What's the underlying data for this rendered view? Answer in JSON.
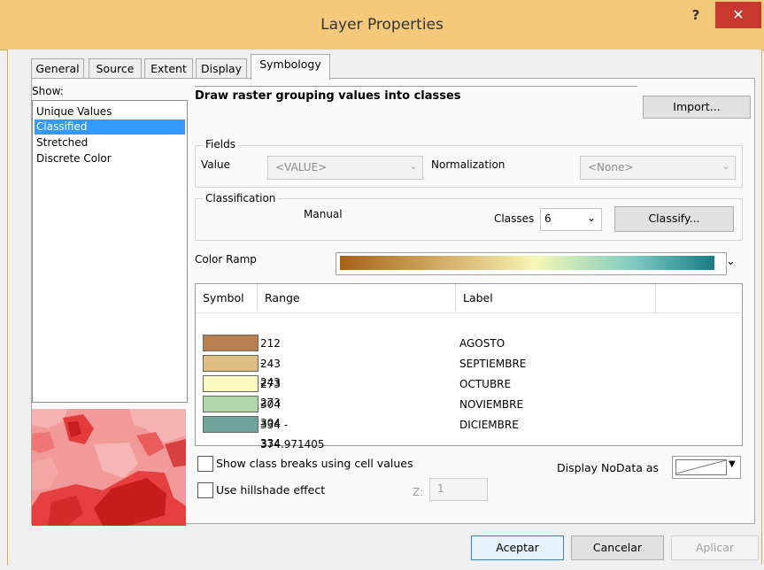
{
  "window": {
    "title": "Layer Properties",
    "help_label": "?",
    "close_label": "✕"
  },
  "tabs": [
    {
      "label": "General"
    },
    {
      "label": "Source"
    },
    {
      "label": "Extent"
    },
    {
      "label": "Display"
    },
    {
      "label": "Symbology",
      "active": true
    }
  ],
  "show": {
    "label": "Show:",
    "items": [
      {
        "label": "Unique Values"
      },
      {
        "label": "Classified",
        "selected": true
      },
      {
        "label": "Stretched"
      },
      {
        "label": "Discrete Color"
      }
    ]
  },
  "heading": "Draw raster grouping values into classes",
  "import_label": "Import...",
  "fields": {
    "legend": "Fields",
    "value_label": "Value",
    "value_select": "<VALUE>",
    "normalization_label": "Normalization",
    "normalization_select": "<None>"
  },
  "classification": {
    "legend": "Classification",
    "method": "Manual",
    "classes_label": "Classes",
    "classes_value": "6",
    "classify_label": "Classify..."
  },
  "color_ramp": {
    "label": "Color Ramp",
    "colors": [
      "#a6611a",
      "#dfc27d",
      "#f7f7b4",
      "#80cdc1",
      "#1a7a86"
    ]
  },
  "table": {
    "headers": {
      "symbol": "Symbol",
      "range": "Range",
      "label": "Label"
    },
    "rows": [
      {
        "color": "#b97f4f",
        "range": "212 - 243",
        "label": "AGOSTO"
      },
      {
        "color": "#dfbe83",
        "range": "243 - 273",
        "label": "SEPTIEMBRE"
      },
      {
        "color": "#fdfbc1",
        "range": "273 - 304",
        "label": "OCTUBRE"
      },
      {
        "color": "#b4d6ad",
        "range": "304 - 334",
        "label": "NOVIEMBRE"
      },
      {
        "color": "#6fa59a",
        "range": "334 - 374.971405",
        "label": "DICIEMBRE"
      }
    ]
  },
  "options": {
    "show_breaks_label": "Show class breaks using cell values",
    "hillshade_label": "Use hillshade effect",
    "z_label": "Z:",
    "z_value": "1",
    "nodata_label": "Display NoData as"
  },
  "footer": {
    "ok_label": "Aceptar",
    "cancel_label": "Cancelar",
    "apply_label": "Aplicar"
  }
}
